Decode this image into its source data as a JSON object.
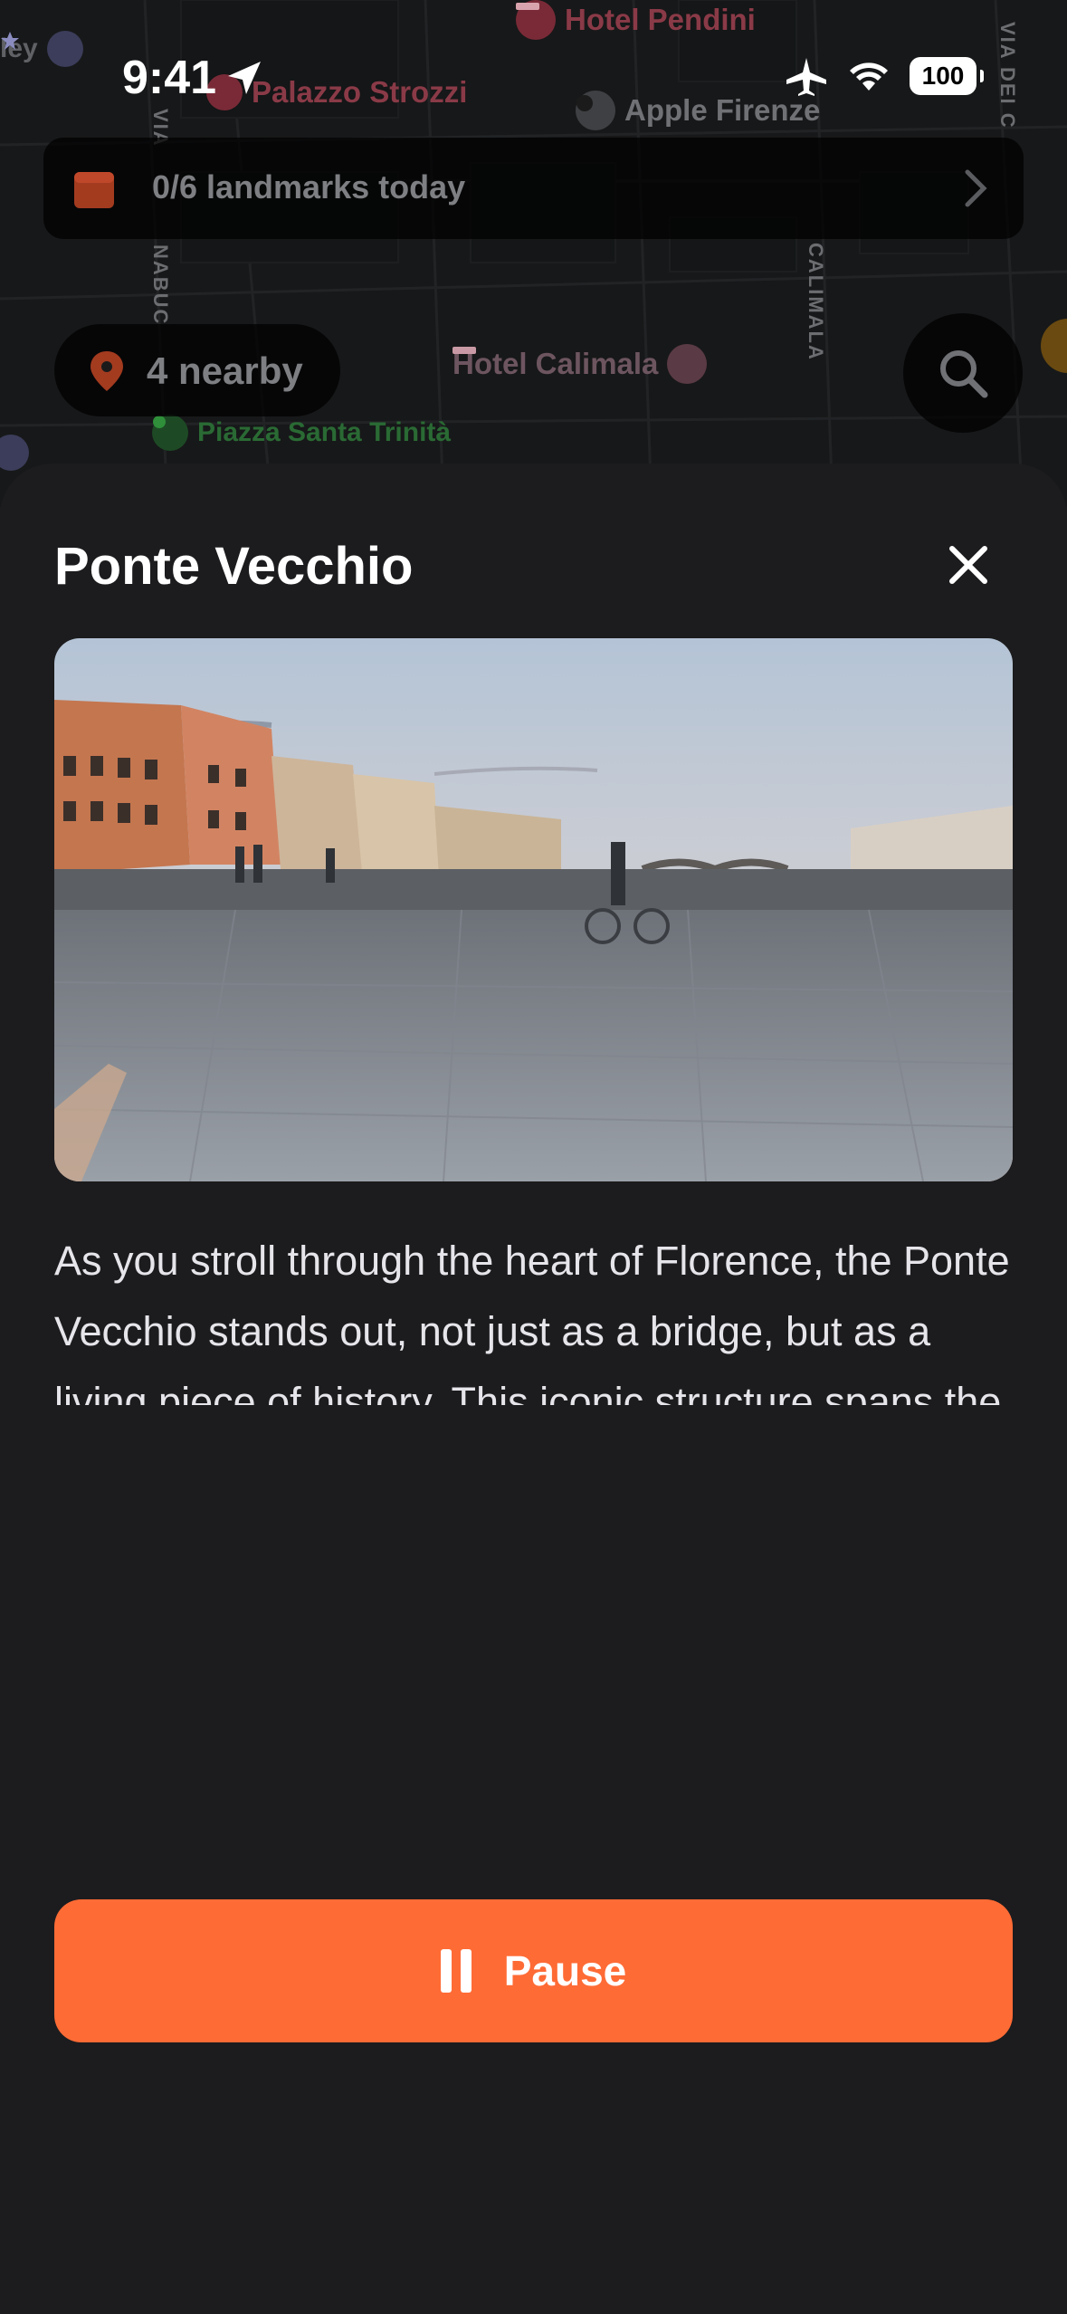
{
  "status_bar": {
    "time": "9:41",
    "battery": "100"
  },
  "map": {
    "pois": {
      "hotel_pendini": "Hotel Pendini",
      "palazzo_strozzi": "Palazzo Strozzi",
      "apple_firenze": "Apple Firenze",
      "hotel_calimala": "Hotel Calimala",
      "piazza_santa_trinita": "Piazza Santa Trinità",
      "partial_left": "ley"
    },
    "streets": {
      "via_dei_calzaiuoli": "VIA DEI C",
      "calimala": "CALIMALA",
      "via_nabucco": "NABUC",
      "via_left": "VIA"
    }
  },
  "banner": {
    "label": "0/6 landmarks today"
  },
  "nearby": {
    "label": "4 nearby"
  },
  "sheet": {
    "title": "Ponte Vecchio",
    "description": "As you stroll through the heart of Florence, the Ponte Vecchio stands out, not just as a bridge, but as a living piece of history. This iconic structure spans the Arno River, connecting the two sides of the city, and it has been a vital part of Florence’s landscape for centuries. Its unique charm lies not only in its architecture but also in the stories it carries, echoing the lives and trades of those who have walked its planks.",
    "pause_label": "Pause"
  },
  "colors": {
    "accent": "#ff6b35",
    "sheet_bg": "#1c1c1e",
    "poi_red": "#c2354d",
    "poi_green": "#2f8f3a"
  },
  "icons": [
    "location-arrow-icon",
    "airplane-icon",
    "wifi-icon",
    "calendar-icon",
    "chevron-right-icon",
    "map-pin-icon",
    "search-icon",
    "close-icon",
    "pause-icon"
  ]
}
